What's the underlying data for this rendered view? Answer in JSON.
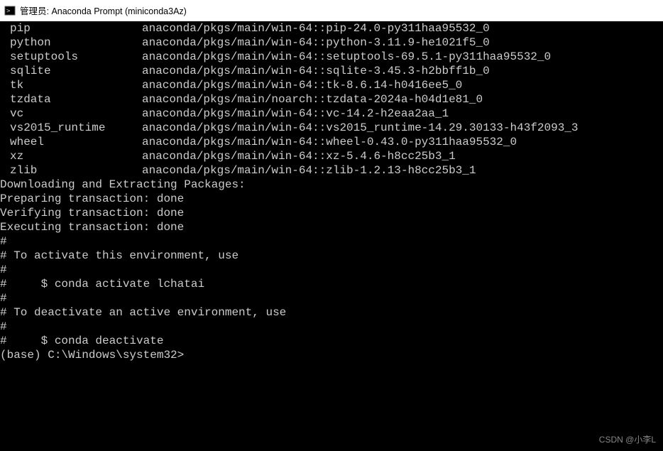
{
  "window": {
    "title": "管理员: Anaconda Prompt (miniconda3Az)"
  },
  "packages": [
    {
      "name": "pip",
      "spec": "anaconda/pkgs/main/win-64::pip-24.0-py311haa95532_0"
    },
    {
      "name": "python",
      "spec": "anaconda/pkgs/main/win-64::python-3.11.9-he1021f5_0"
    },
    {
      "name": "setuptools",
      "spec": "anaconda/pkgs/main/win-64::setuptools-69.5.1-py311haa95532_0"
    },
    {
      "name": "sqlite",
      "spec": "anaconda/pkgs/main/win-64::sqlite-3.45.3-h2bbff1b_0"
    },
    {
      "name": "tk",
      "spec": "anaconda/pkgs/main/win-64::tk-8.6.14-h0416ee5_0"
    },
    {
      "name": "tzdata",
      "spec": "anaconda/pkgs/main/noarch::tzdata-2024a-h04d1e81_0"
    },
    {
      "name": "vc",
      "spec": "anaconda/pkgs/main/win-64::vc-14.2-h2eaa2aa_1"
    },
    {
      "name": "vs2015_runtime",
      "spec": "anaconda/pkgs/main/win-64::vs2015_runtime-14.29.30133-h43f2093_3"
    },
    {
      "name": "wheel",
      "spec": "anaconda/pkgs/main/win-64::wheel-0.43.0-py311haa95532_0"
    },
    {
      "name": "xz",
      "spec": "anaconda/pkgs/main/win-64::xz-5.4.6-h8cc25b3_1"
    },
    {
      "name": "zlib",
      "spec": "anaconda/pkgs/main/win-64::zlib-1.2.13-h8cc25b3_1"
    }
  ],
  "messages": {
    "blank1": "",
    "blank2": "",
    "downloading": "Downloading and Extracting Packages:",
    "blank3": "",
    "preparing": "Preparing transaction: done",
    "verifying": "Verifying transaction: done",
    "executing": "Executing transaction: done",
    "h1": "#",
    "activate_hdr": "# To activate this environment, use",
    "h2": "#",
    "activate_cmd": "#     $ conda activate lchatai",
    "h3": "#",
    "deactivate_hdr": "# To deactivate an active environment, use",
    "h4": "#",
    "deactivate_cmd": "#     $ conda deactivate",
    "blank4": "",
    "prompt": "(base) C:\\Windows\\system32>"
  },
  "watermark": "CSDN @小李L"
}
